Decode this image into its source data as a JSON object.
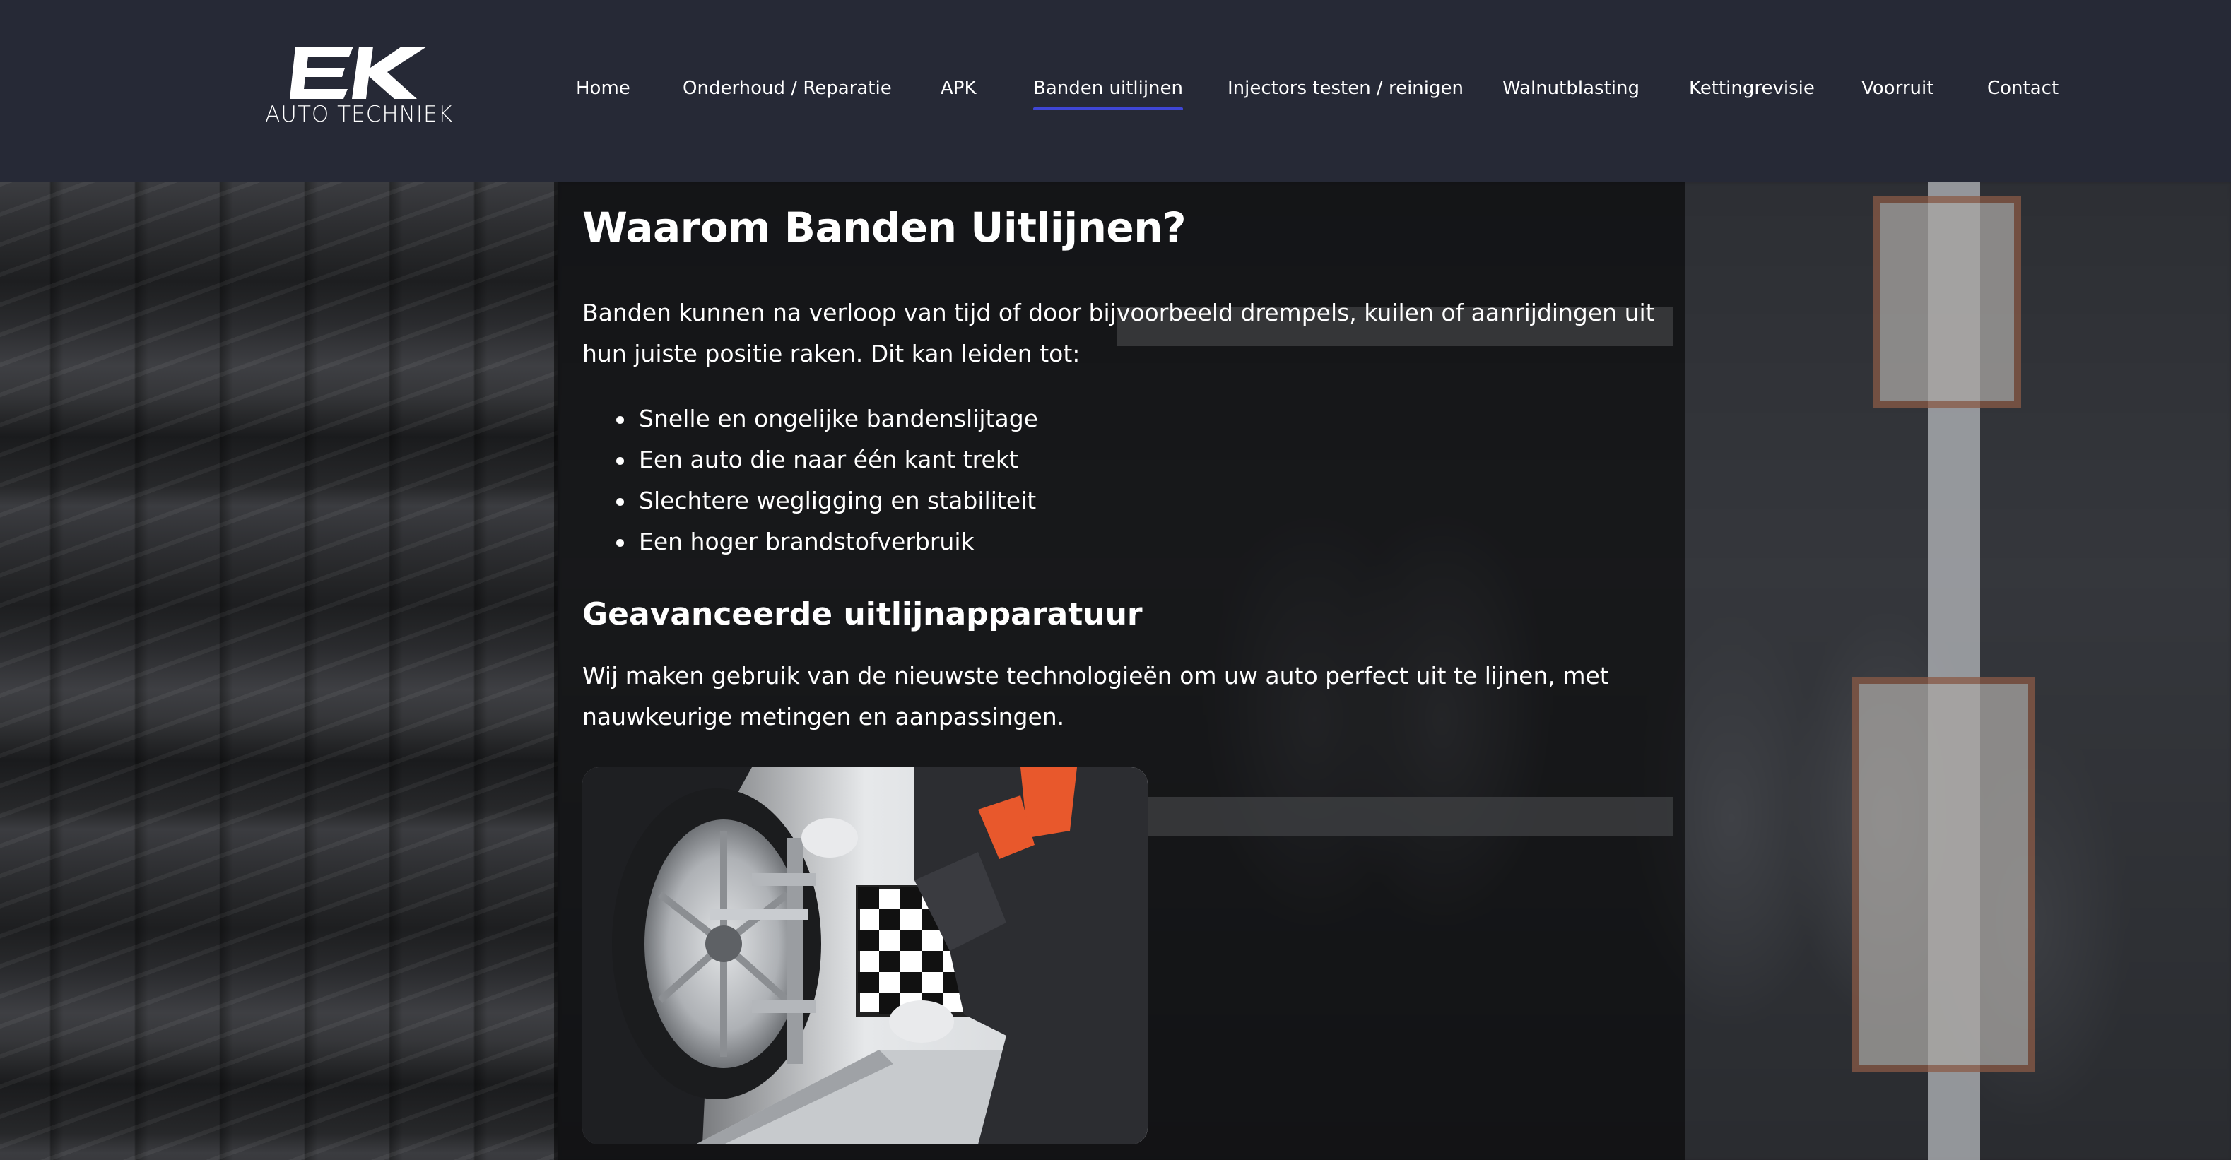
{
  "brand": {
    "logo_mark": "EK",
    "logo_text": "AUTO TECHNIEK"
  },
  "nav": {
    "items": [
      {
        "label": "Home"
      },
      {
        "label": "Onderhoud / Reparatie"
      },
      {
        "label": "APK"
      },
      {
        "label": "Banden uitlijnen"
      },
      {
        "label": "Injectors testen / reinigen"
      },
      {
        "label": "Walnutblasting"
      },
      {
        "label": "Kettingrevisie"
      },
      {
        "label": "Voorruit"
      },
      {
        "label": "Contact"
      }
    ],
    "active_index": 3,
    "active_color": "#3f46d6"
  },
  "main": {
    "title": "Waarom Banden Uitlijnen?",
    "intro": "Banden kunnen na verloop van tijd of door bijvoorbeeld drempels, kuilen of aanrijdingen uit hun juiste positie raken. Dit kan leiden tot:",
    "bullets": [
      "Snelle en ongelijke bandenslijtage",
      "Een auto die naar één kant trekt",
      "Slechtere wegligging en stabiliteit",
      "Een hoger brandstofverbruik"
    ],
    "subtitle": "Geavanceerde uitlijnapparatuur",
    "description": "Wij maken gebruik van de nieuwste technologieën om uw auto perfect uit te lijnen, met nauwkeurige metingen en aanpassingen."
  },
  "colors": {
    "header_bg": "#262936",
    "text": "#ffffff",
    "accent_orange": "#e8582c"
  }
}
